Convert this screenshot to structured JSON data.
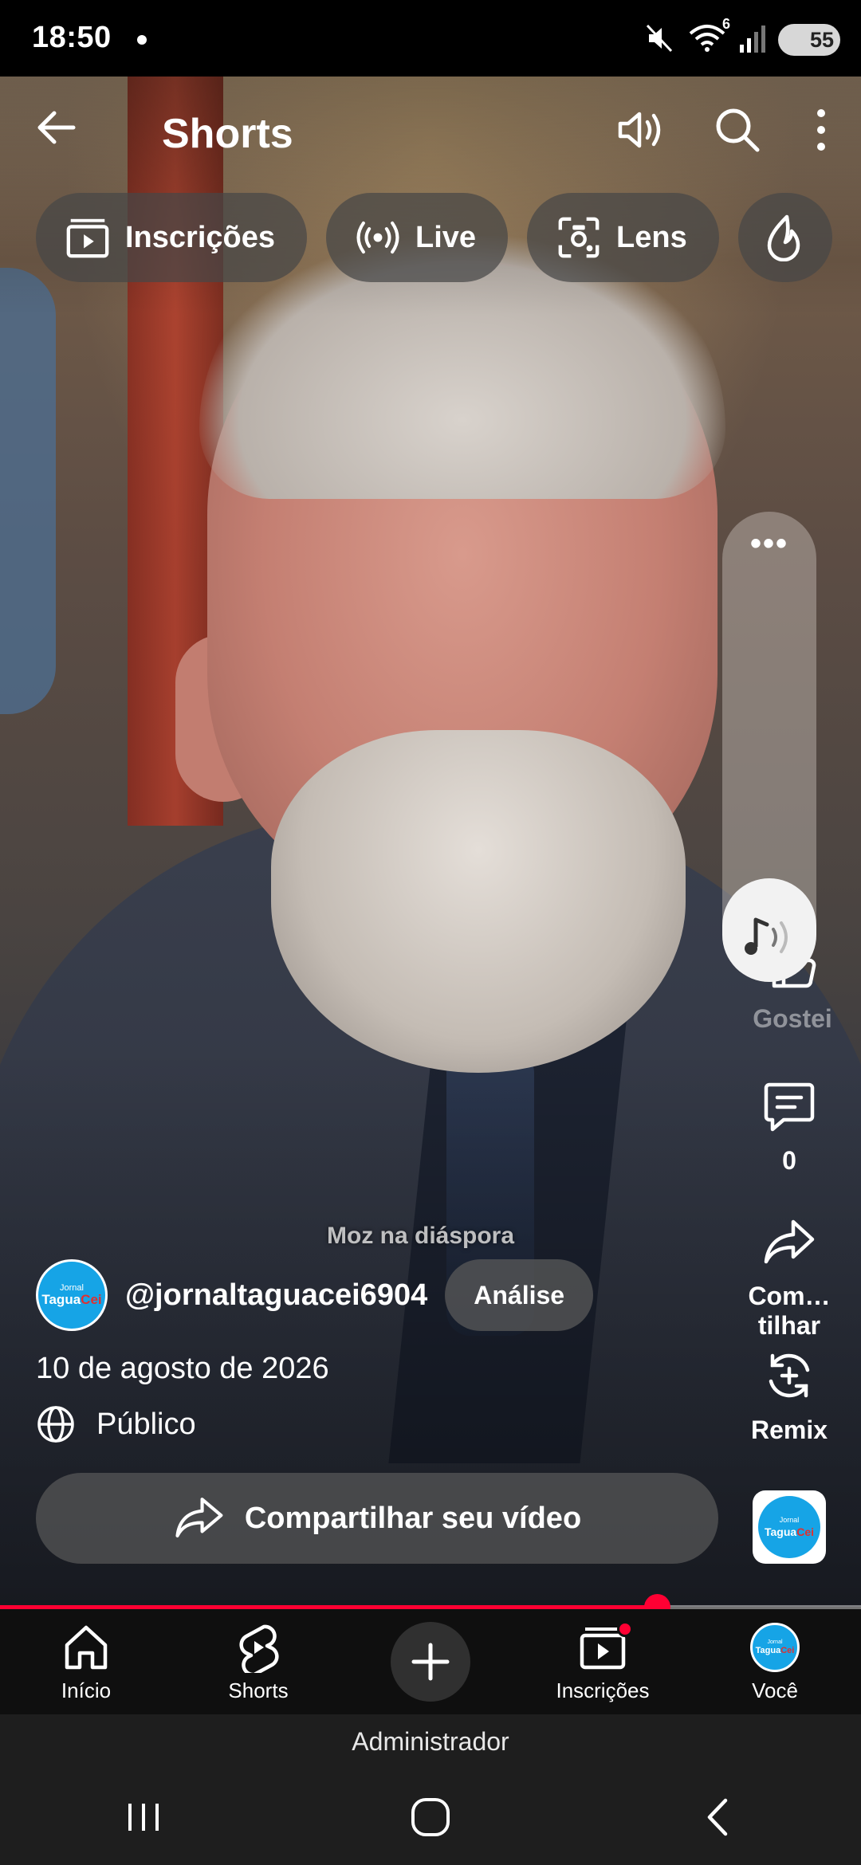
{
  "status_bar": {
    "time": "18:50",
    "battery": "55",
    "wifi_badge": "6",
    "icons": [
      "mute-icon",
      "wifi-icon",
      "signal-icon",
      "battery-icon"
    ]
  },
  "header": {
    "title": "Shorts",
    "actions": [
      "volume-icon",
      "search-icon",
      "more-vert-icon"
    ]
  },
  "chips": [
    {
      "label": "Inscrições",
      "icon": "subscriptions-icon"
    },
    {
      "label": "Live",
      "icon": "live-icon"
    },
    {
      "label": "Lens",
      "icon": "lens-icon"
    },
    {
      "label": "",
      "icon": "trending-icon"
    }
  ],
  "volume_panel": {
    "level": 0.22,
    "more_label": "•••",
    "icon": "music-volume-icon"
  },
  "rail": {
    "like_label": "Gostei",
    "comment_count": "0",
    "share_label": "Com…tilhar",
    "remix_label": "Remix"
  },
  "watermark": "Moz na diáspora",
  "channel": {
    "handle": "@jornaltaguacei6904",
    "avatar_small": "Jornal",
    "avatar_main": "Tagua",
    "avatar_accent": "Cei",
    "analysis_button": "Análise"
  },
  "date": "10 de agosto de 2026",
  "visibility": "Público",
  "share_video_button": "Compartilhar seu vídeo",
  "progress": {
    "fraction": 0.763
  },
  "bottom_nav": [
    {
      "label": "Início",
      "icon": "home-icon"
    },
    {
      "label": "Shorts",
      "icon": "shorts-icon"
    },
    {
      "label": "",
      "icon": "add-icon"
    },
    {
      "label": "Inscrições",
      "icon": "subscriptions-icon"
    },
    {
      "label": "Você",
      "icon": "profile-avatar"
    }
  ],
  "admin_label": "Administrador",
  "system_nav": [
    "recents-icon",
    "home-icon",
    "back-icon"
  ],
  "colors": {
    "accent": "#ff0033",
    "avatar_blue": "#16a4e6"
  }
}
